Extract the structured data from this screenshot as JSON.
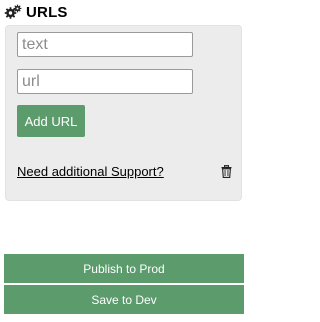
{
  "header": {
    "icon": "gears-icon",
    "title": "URLS"
  },
  "url_form": {
    "text_placeholder": "text",
    "url_placeholder": "url",
    "text_value": "",
    "url_value": "",
    "add_label": "Add URL"
  },
  "support": {
    "link_label": "Need additional Support?",
    "delete_icon": "trash-icon"
  },
  "actions": {
    "publish_label": "Publish to Prod",
    "save_label": "Save to Dev"
  },
  "colors": {
    "accent": "#5b9b6c",
    "panel_bg": "#ececec"
  }
}
